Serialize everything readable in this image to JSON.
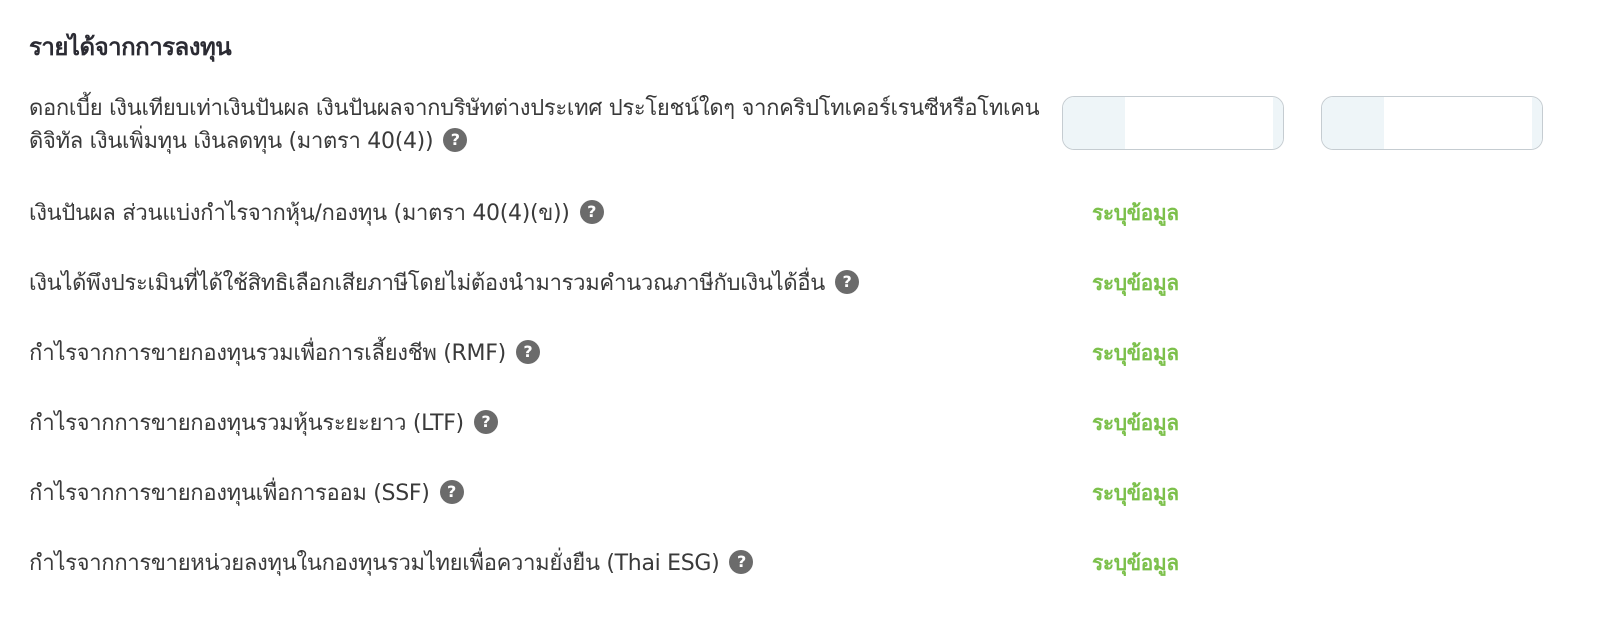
{
  "section": {
    "title": "รายได้จากการลงทุน"
  },
  "rows": [
    {
      "label": "ดอกเบี้ย เงินเทียบเท่าเงินปันผล เงินปันผลจากบริษัทต่างประเทศ ประโยชน์ใดๆ จากคริปโทเคอร์เรนซีหรือโทเคนดิจิทัล เงินเพิ่มทุน เงินลดทุน (มาตรา 40(4))",
      "input_1_value": "",
      "input_2_value": ""
    },
    {
      "label": "เงินปันผล ส่วนแบ่งกำไรจากหุ้น/กองทุน (มาตรา 40(4)(ข))",
      "action": "ระบุข้อมูล"
    },
    {
      "label": "เงินได้พึงประเมินที่ได้ใช้สิทธิเลือกเสียภาษีโดยไม่ต้องนำมารวมคำนวณภาษีกับเงินได้อื่น",
      "action": "ระบุข้อมูล"
    },
    {
      "label": "กำไรจากการขายกองทุนรวมเพื่อการเลี้ยงชีพ (RMF)",
      "action": "ระบุข้อมูล"
    },
    {
      "label": "กำไรจากการขายกองทุนรวมหุ้นระยะยาว (LTF)",
      "action": "ระบุข้อมูล"
    },
    {
      "label": "กำไรจากการขายกองทุนเพื่อการออม (SSF)",
      "action": "ระบุข้อมูล"
    },
    {
      "label": "กำไรจากการขายหน่วยลงทุนในกองทุนรวมไทยเพื่อความยั่งยืน (Thai ESG)",
      "action": "ระบุข้อมูล"
    }
  ],
  "help_icon_glyph": "?",
  "colors": {
    "action_link": "#7cc04b",
    "help_icon": "#6b6b6b",
    "title": "#2b2b33"
  }
}
